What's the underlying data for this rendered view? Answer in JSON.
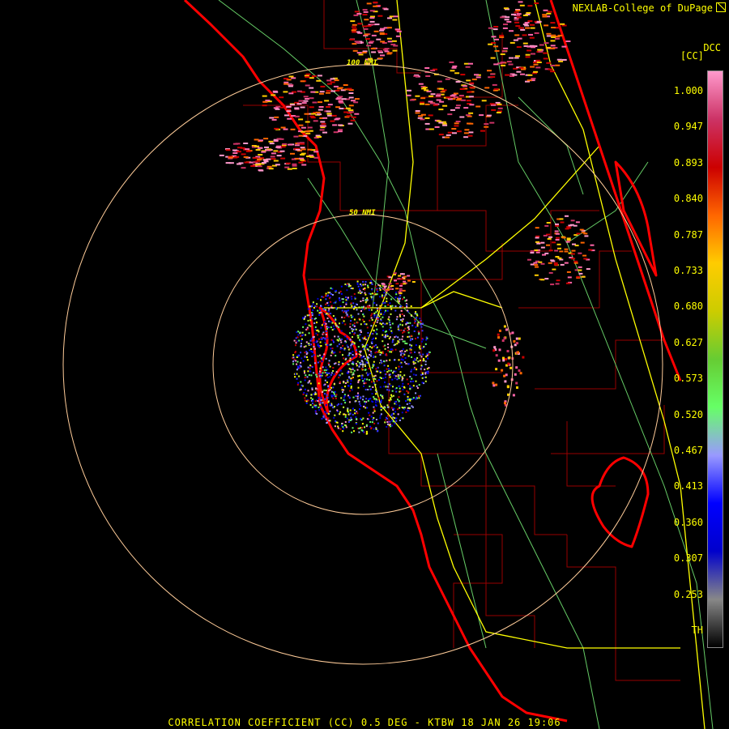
{
  "credit": "NEXLAB-College of DuPage",
  "product_code": "DCC",
  "units": "[CC]",
  "footer": "CORRELATION COEFFICIENT (CC) 0.5 DEG - KTBW 18 JAN 26 19:06",
  "range_rings": [
    {
      "label": "50 NMI"
    },
    {
      "label": "100 NMI"
    }
  ],
  "colorbar": {
    "labels": [
      "1.000",
      "0.947",
      "0.893",
      "0.840",
      "0.787",
      "0.733",
      "0.680",
      "0.627",
      "0.573",
      "0.520",
      "0.467",
      "0.413",
      "0.360",
      "0.307",
      "0.253",
      "TH"
    ],
    "colors": [
      "#ff99cc",
      "#cc3366",
      "#cc0000",
      "#ff6600",
      "#ffcc00",
      "#cccc00",
      "#66cc33",
      "#66ff66",
      "#9999ff",
      "#0000ff",
      "#0000cc",
      "#888888",
      "#000000"
    ]
  },
  "colors": {
    "state_border": "#ff0000",
    "county_lines": "#990000",
    "highways": "#ffff00",
    "roads": "#66cc66",
    "rings": "#ffcc99",
    "text": "#ffff00"
  }
}
